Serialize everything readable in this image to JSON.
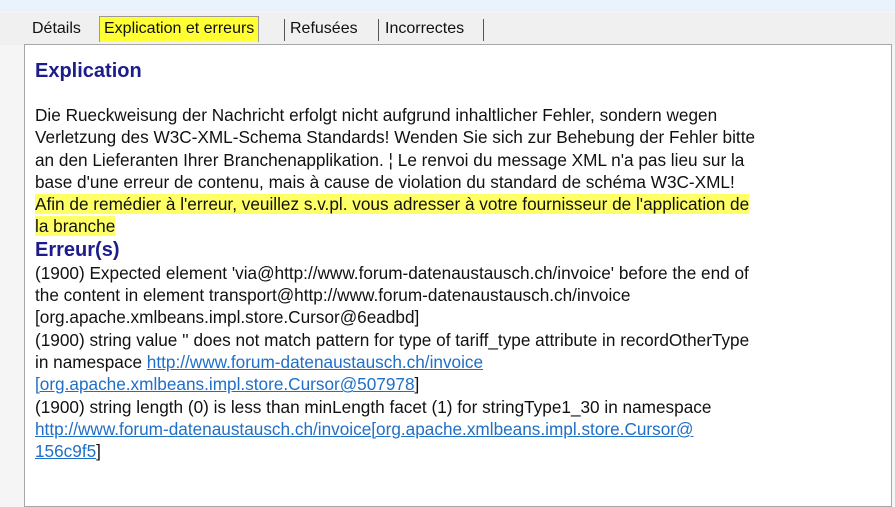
{
  "tabs": [
    {
      "label": "Détails"
    },
    {
      "label": "Explication et erreurs"
    },
    {
      "label": "Refusées"
    },
    {
      "label": "Incorrectes"
    }
  ],
  "explanation": {
    "heading": "Explication",
    "lines": [
      "Die Rueckweisung der Nachricht erfolgt nicht aufgrund inhaltlicher Fehler, sondern wegen",
      "Verletzung des W3C-XML-Schema Standards! Wenden Sie sich zur Behebung der Fehler bitte",
      "an den Lieferanten Ihrer Branchenapplikation. ¦ Le renvoi du message XML n'a pas lieu sur la",
      "base d'une erreur de contenu, mais à cause de violation du standard de schéma W3C-XML!"
    ],
    "highlight_lines": [
      "Afin de remédier à l'erreur, veuillez s.v.pl. vous adresser à votre fournisseur de l'application de",
      "la branche"
    ],
    "highlight_color": "#ffff66"
  },
  "errors": {
    "heading": "Erreur(s)",
    "e1_line1": "(1900) Expected element 'via@http://www.forum-datenaustausch.ch/invoice' before the end of",
    "e1_line2": "the content in element transport@http://www.forum-datenaustausch.ch/invoice",
    "e1_line3": "[org.apache.xmlbeans.impl.store.Cursor@6eadbd]",
    "e2_line1": "(1900) string value '' does not match pattern for type of tariff_type attribute in recordOtherType",
    "e2_line2_prefix": "in namespace ",
    "e2_link1": "http://www.forum-datenaustausch.ch/invoice",
    "e2_link2": "[org.apache.xmlbeans.impl.store.Cursor@507978",
    "e2_suffix": "]",
    "e3_line1": "(1900) string length (0) is less than minLength facet (1) for stringType1_30 in namespace",
    "e3_link1": "http://www.forum-datenaustausch.ch/invoice[org.apache.xmlbeans.impl.store.Cursor@",
    "e3_link2": "156c9f5",
    "e3_suffix": "]"
  }
}
